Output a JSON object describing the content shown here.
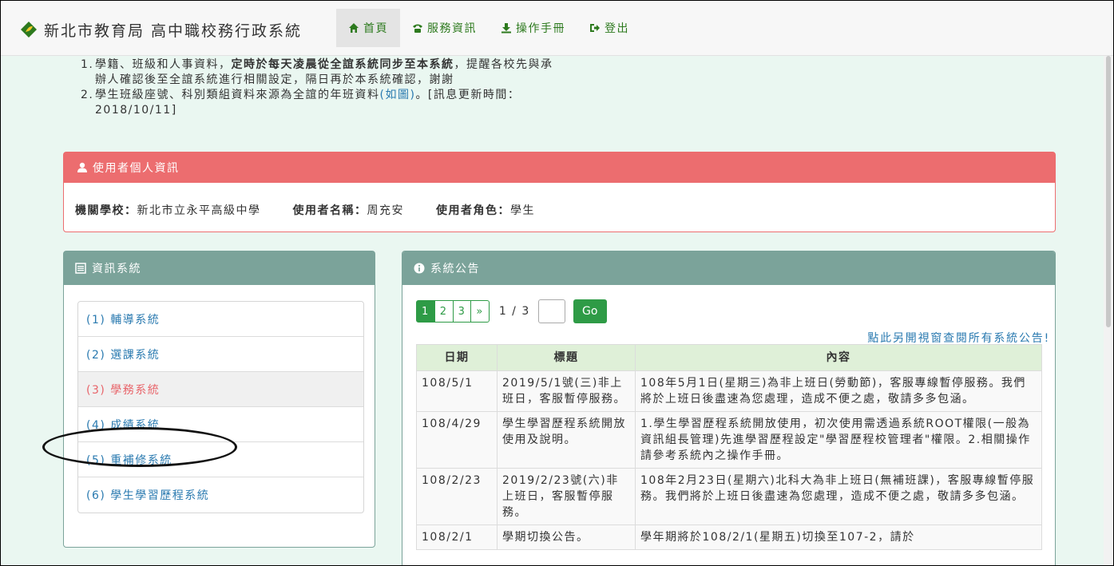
{
  "header": {
    "brand": "新北市教育局 高中職校務行政系統",
    "nav": [
      {
        "label": "首頁",
        "icon": "home-icon"
      },
      {
        "label": "服務資訊",
        "icon": "phone-icon"
      },
      {
        "label": "操作手冊",
        "icon": "download-icon"
      },
      {
        "label": "登出",
        "icon": "logout-icon"
      }
    ]
  },
  "notices": [
    {
      "num": "1.",
      "pre": "學籍、班級和人事資料，",
      "bold": "定時於每天凌晨從全誼系統同步至本系統",
      "post": "，提醒各校先與承辦人確認後至全誼系統進行相關設定，隔日再於本系統確認，謝謝"
    },
    {
      "num": "2.",
      "pre": "學生班級座號、科別類組資料來源為全誼的年班資料",
      "link": "(如圖)",
      "post": "。[訊息更新時間：2018/10/11]"
    }
  ],
  "user_panel": {
    "title": "使用者個人資訊",
    "school_label": "機關學校：",
    "school": "新北市立永平高級中學",
    "name_label": "使用者名稱：",
    "name": "周充安",
    "role_label": "使用者角色：",
    "role": "學生"
  },
  "systems_panel": {
    "title": "資訊系統",
    "items": [
      "(1) 輔導系統",
      "(2) 選課系統",
      "(3) 學務系統",
      "(4) 成績系統",
      "(5) 重補修系統",
      "(6) 學生學習歷程系統"
    ]
  },
  "announcements": {
    "title": "系統公告",
    "pages": [
      "1",
      "2",
      "3",
      "»"
    ],
    "page_info": "1 / 3",
    "go": "Go",
    "view_all": "點此另開視窗查閱所有系統公告!",
    "columns": [
      "日期",
      "標題",
      "內容"
    ],
    "rows": [
      {
        "date": "108/5/1",
        "title": "2019/5/1號(三)非上班日，客服暫停服務。",
        "content": "108年5月1日(星期三)為非上班日(勞動節)，客服專線暫停服務。我們將於上班日後盡速為您處理，造成不便之處，敬請多多包涵。"
      },
      {
        "date": "108/4/29",
        "title": "學生學習歷程系統開放使用及說明。",
        "content": "1.學生學習歷程系統開放使用，初次使用需透過系統ROOT權限(一般為資訊組長管理)先進學習歷程設定\"學習歷程校管理者\"權限。2.相關操作請參考系統內之操作手冊。"
      },
      {
        "date": "108/2/23",
        "title": "2019/2/23號(六)非上班日，客服暫停服務。",
        "content": "108年2月23日(星期六)北科大為非上班日(無補班課)，客服專線暫停服務。我們將於上班日後盡速為您處理，造成不便之處，敬請多多包涵。"
      },
      {
        "date": "108/2/1",
        "title": "學期切換公告。",
        "content": "學年期將於108/2/1(星期五)切換至107-2，請於"
      }
    ]
  },
  "colors": {
    "accent_green": "#2e9b46",
    "danger": "#ec6d6f",
    "teal": "#7ba39a",
    "bg": "#eaf7f1"
  }
}
